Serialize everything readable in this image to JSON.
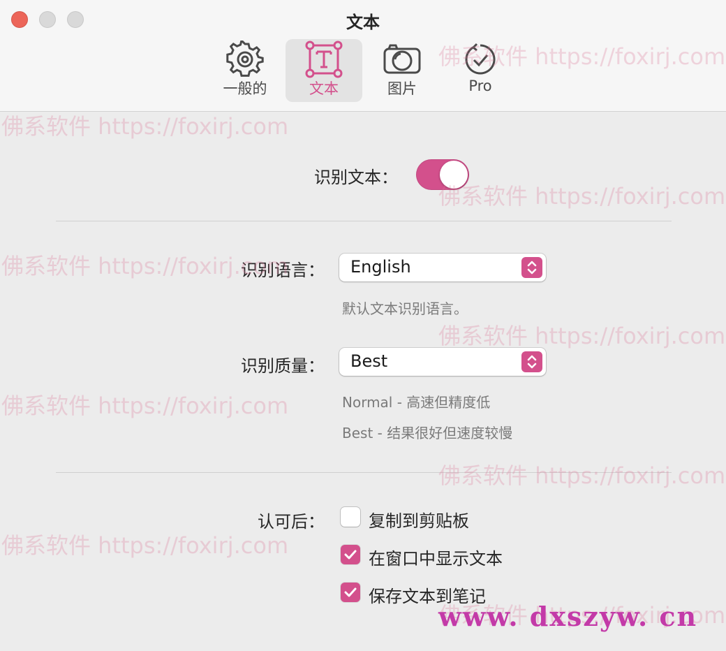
{
  "window": {
    "title": "文本"
  },
  "tabs": [
    {
      "label": "一般的",
      "icon": "gear-icon"
    },
    {
      "label": "文本",
      "icon": "text-frame-icon"
    },
    {
      "label": "图片",
      "icon": "camera-icon"
    },
    {
      "label": "Pro",
      "icon": "checkmark-circle-icon"
    }
  ],
  "active_tab": "文本",
  "recognize_text": {
    "label": "识别文本：",
    "enabled": true
  },
  "language": {
    "label": "识别语言：",
    "value": "English",
    "hint": "默认文本识别语言。"
  },
  "quality": {
    "label": "识别质量：",
    "value": "Best",
    "hint_normal": "Normal - 高速但精度低",
    "hint_best": "Best - 结果很好但速度较慢"
  },
  "after_recognition": {
    "label": "认可后：",
    "options": [
      {
        "label": "复制到剪贴板",
        "checked": false
      },
      {
        "label": "在窗口中显示文本",
        "checked": true
      },
      {
        "label": "保存文本到笔记",
        "checked": true
      }
    ]
  },
  "watermarks": {
    "text": "佛系软件 https://foxirj.com",
    "bottom": "www. dxszyw. cn"
  },
  "colors": {
    "accent": "#d3508c",
    "close": "#ec6559"
  }
}
